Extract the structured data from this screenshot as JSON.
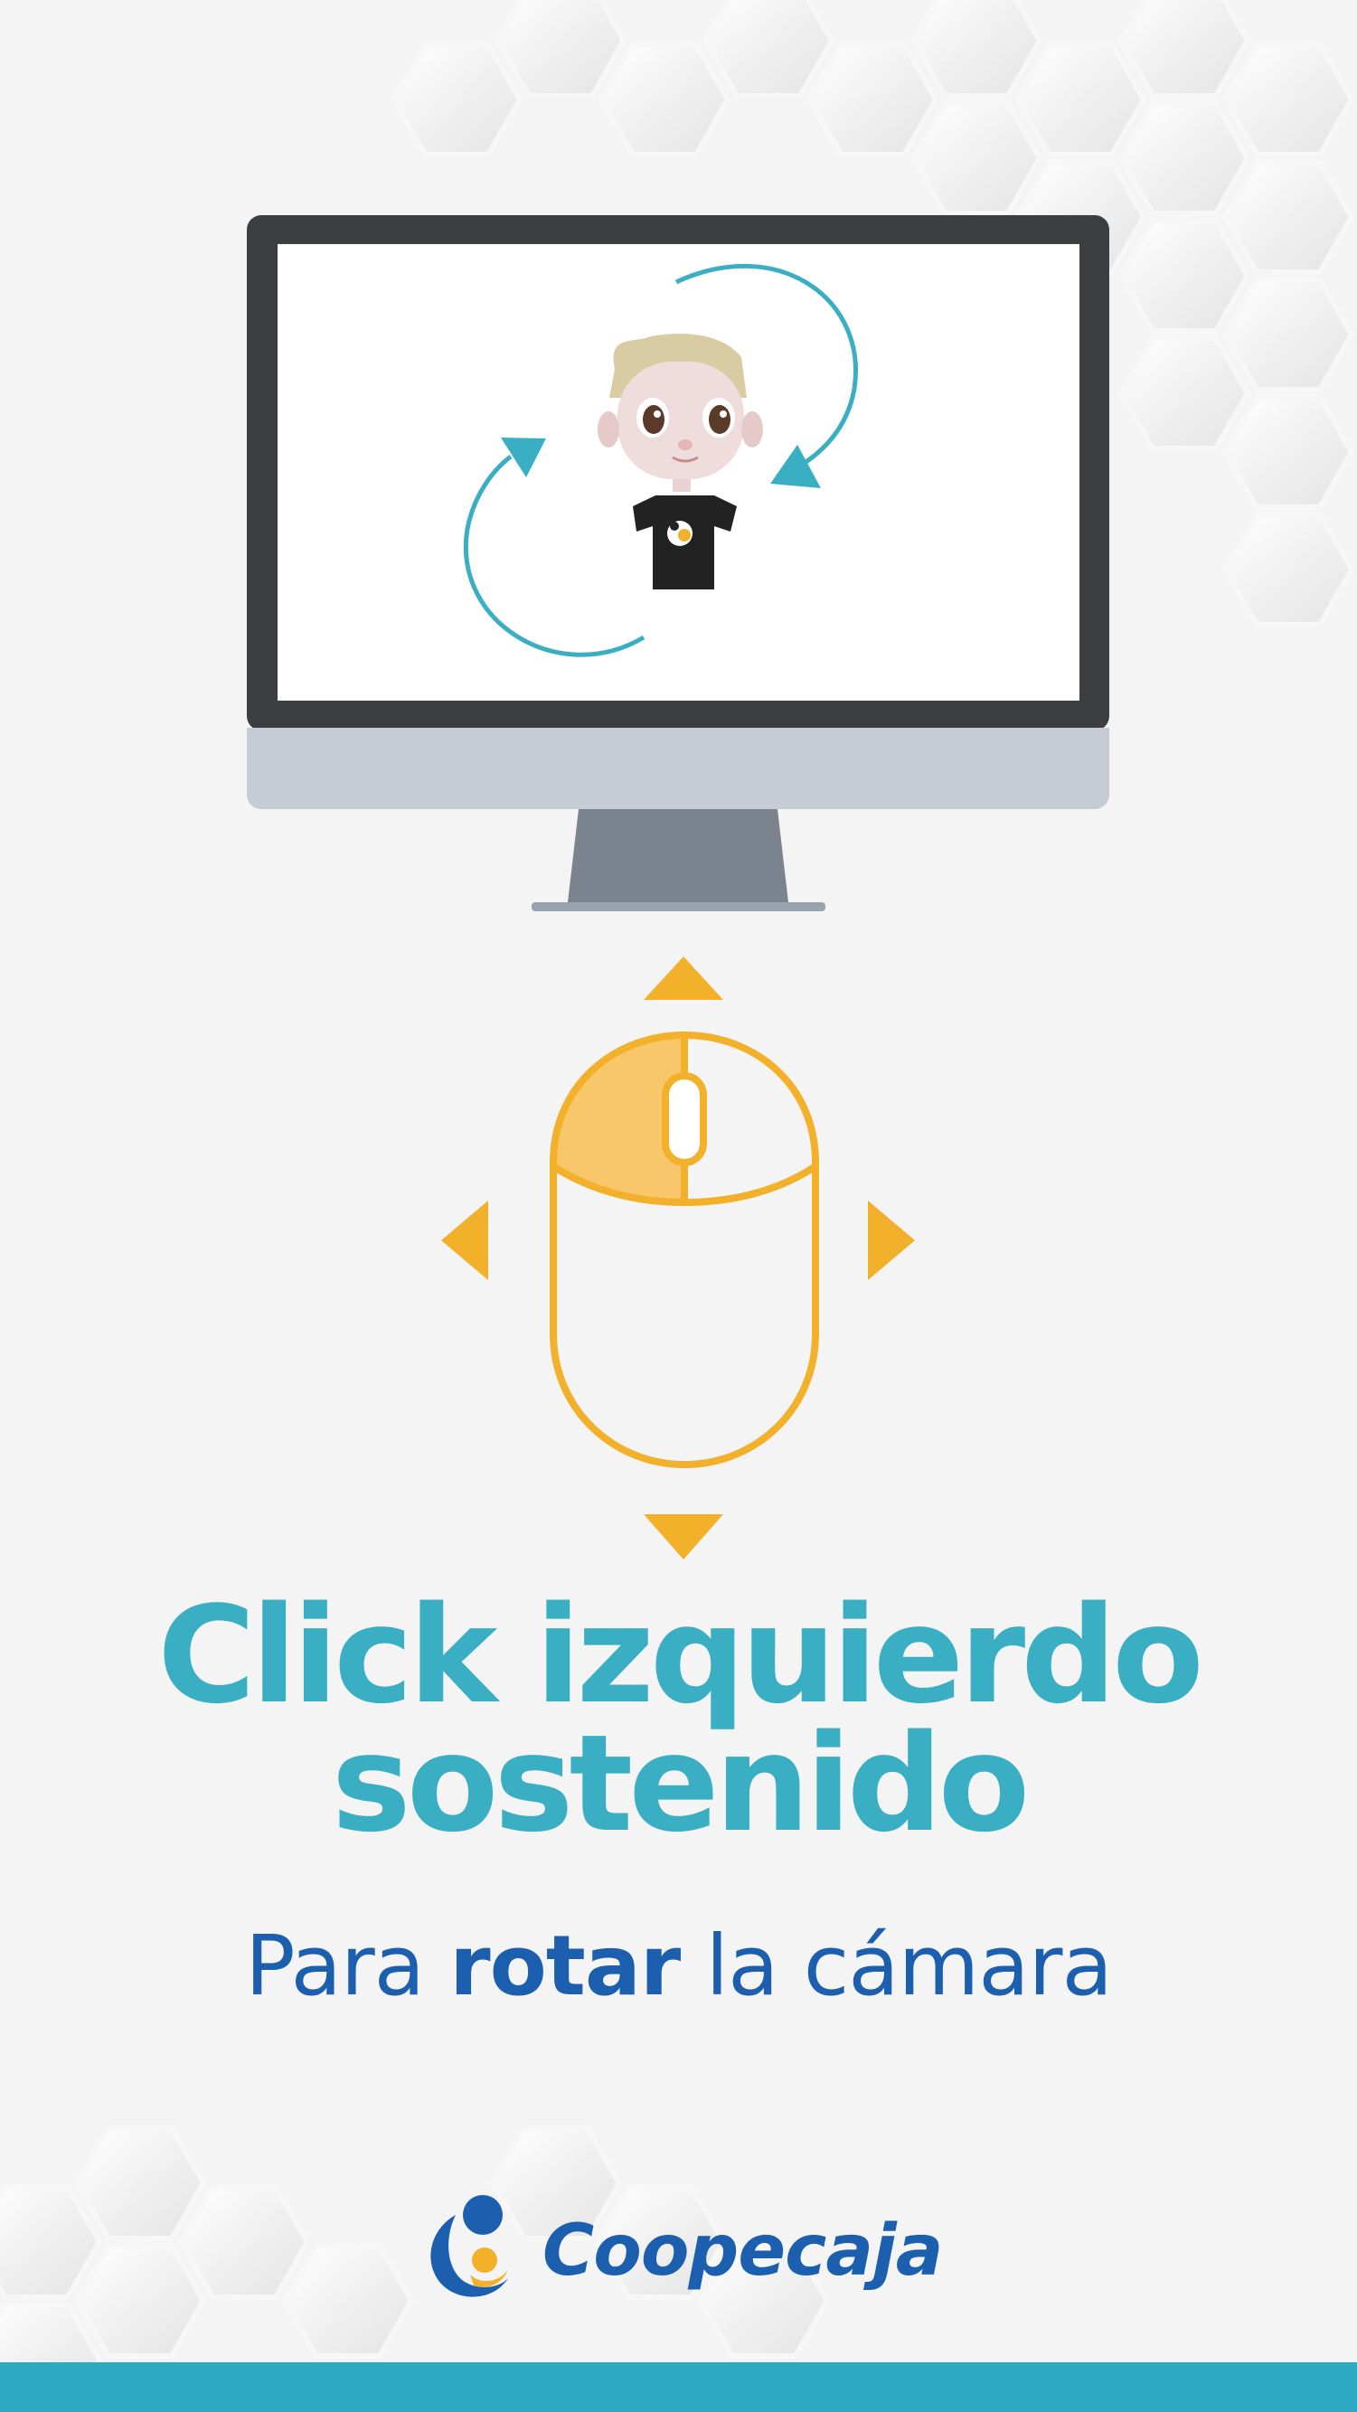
{
  "headline": {
    "line1": "Click izquierdo",
    "line2": "sostenido"
  },
  "subline": {
    "prefix": "Para ",
    "emphasis": "rotar",
    "suffix": " la cámara"
  },
  "brand": {
    "name": "Coopecaja"
  },
  "colors": {
    "teal": "#3aafc4",
    "blue": "#1b5fae",
    "orange": "#f3b02b",
    "orange_light": "#f8c76a",
    "monitor_frame": "#3d3e40",
    "monitor_chin": "#c6ccd6",
    "stand": "#7b838e",
    "bar": "#2fa8c2"
  },
  "icons": {
    "hexagon_pattern": "hexagon-pattern",
    "monitor": "monitor-icon",
    "avatar": "avatar-figure",
    "rotate_arrows": "rotate-arrows-icon",
    "mouse": "mouse-icon",
    "direction_arrows": "direction-arrows-icon",
    "logo": "coopecaja-logo-icon"
  }
}
